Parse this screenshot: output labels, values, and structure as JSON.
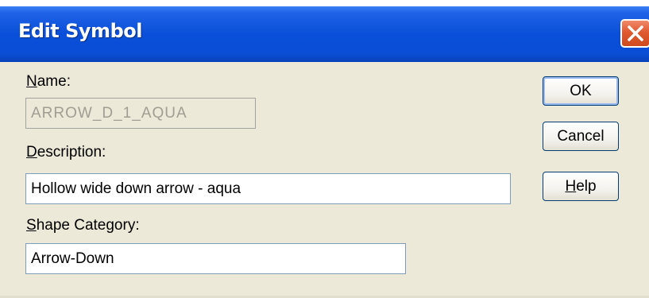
{
  "dialog": {
    "title": "Edit Symbol"
  },
  "fields": {
    "name": {
      "label_mnemonic": "N",
      "label_rest": "ame:",
      "value": "ARROW_D_1_AQUA",
      "disabled": true
    },
    "description": {
      "label_mnemonic": "D",
      "label_rest": "escription:",
      "value": "Hollow wide down arrow - aqua"
    },
    "shape_category": {
      "label_mnemonic": "S",
      "label_rest": "hape Category:",
      "value": "Arrow-Down"
    }
  },
  "buttons": {
    "ok": "OK",
    "cancel": "Cancel",
    "help_mnemonic": "H",
    "help_rest": "elp"
  },
  "colors": {
    "titlebar": "#0a4fd9",
    "dialog_background": "#ece9d8",
    "close_button": "#e05a30"
  },
  "icons": {
    "close": "close-x-icon"
  }
}
